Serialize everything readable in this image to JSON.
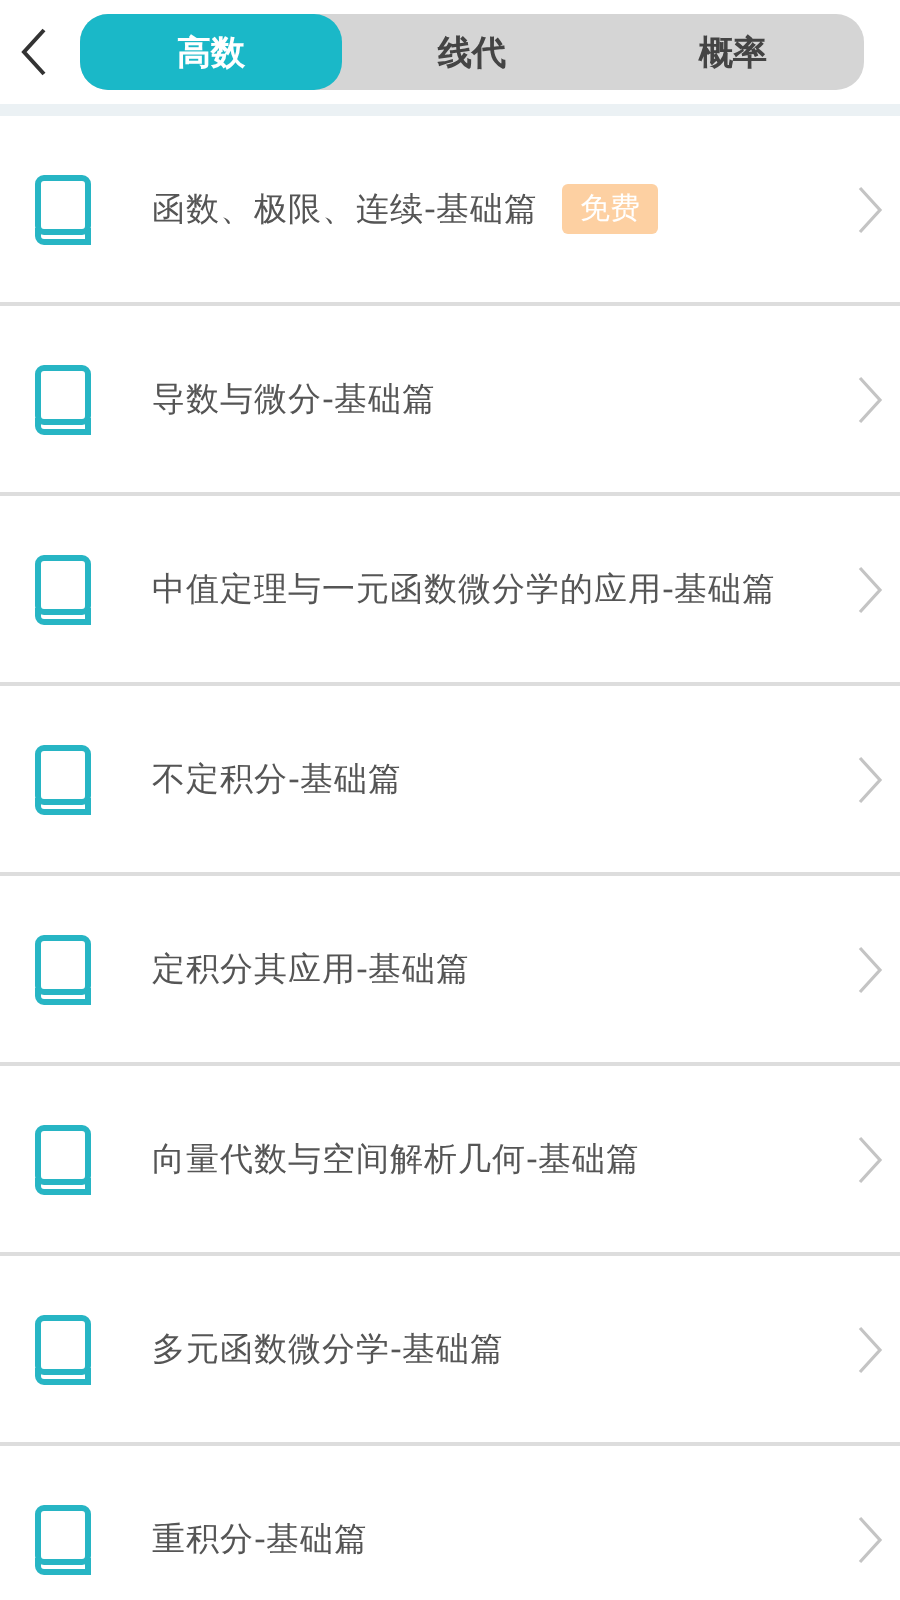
{
  "tabs": [
    {
      "label": "高数",
      "selected": true
    },
    {
      "label": "线代",
      "selected": false
    },
    {
      "label": "概率",
      "selected": false
    }
  ],
  "chapters": [
    {
      "title": "函数、极限、连续-基础篇",
      "badge": "免费"
    },
    {
      "title": "导数与微分-基础篇"
    },
    {
      "title": "中值定理与一元函数微分学的应用-基础篇"
    },
    {
      "title": "不定积分-基础篇"
    },
    {
      "title": "定积分其应用-基础篇"
    },
    {
      "title": "向量代数与空间解析几何-基础篇"
    },
    {
      "title": "多元函数微分学-基础篇"
    },
    {
      "title": "重积分-基础篇"
    }
  ]
}
